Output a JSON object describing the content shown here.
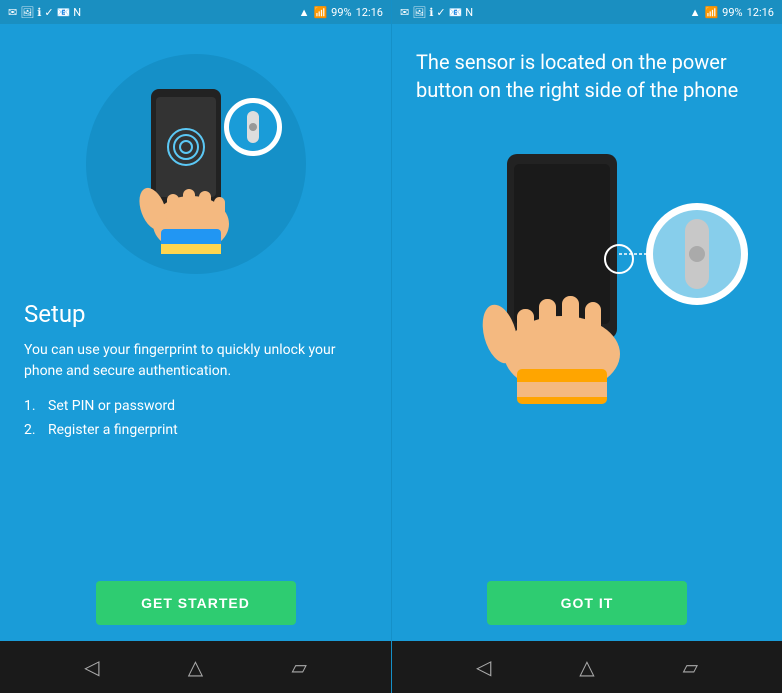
{
  "left_panel": {
    "status_bar": {
      "time": "12:16",
      "battery": "99%"
    },
    "title": "Setup",
    "description": "You can use your fingerprint to quickly unlock your phone and secure authentication.",
    "steps": [
      {
        "number": "1.",
        "text": "Set PIN or password"
      },
      {
        "number": "2.",
        "text": "Register a fingerprint"
      }
    ],
    "button_label": "GET STARTED",
    "nav": {
      "back": "◁",
      "home": "△",
      "recents": "▱"
    }
  },
  "right_panel": {
    "status_bar": {
      "time": "12:16",
      "battery": "99%"
    },
    "sensor_text": "The sensor is located on the power button on the right side of the phone",
    "button_label": "GOT IT",
    "nav": {
      "back": "◁",
      "home": "△",
      "recents": "▱"
    }
  },
  "colors": {
    "bg": "#1a9cd8",
    "circle": "#1590c8",
    "button": "#2ecc71",
    "text": "#ffffff",
    "navbar": "#1a1a1a"
  }
}
